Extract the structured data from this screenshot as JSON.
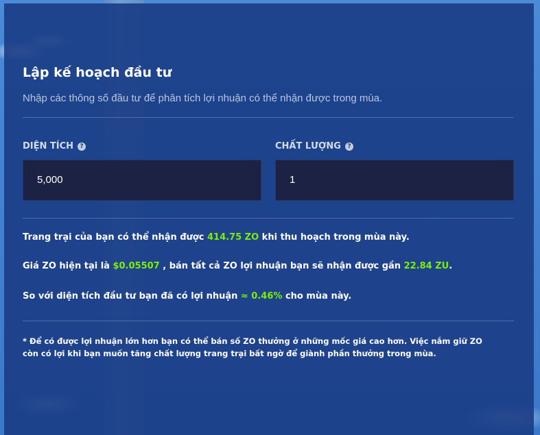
{
  "planner": {
    "title": "Lập kế hoạch đầu tư",
    "subtitle": "Nhập các thông số đầu tư để phân tích lợi nhuận có thể nhận được trong mùa."
  },
  "fields": {
    "area": {
      "label": "DIỆN TÍCH",
      "value": "5,000"
    },
    "quality": {
      "label": "CHẤT LƯỢNG",
      "value": "1"
    }
  },
  "results": {
    "line1": {
      "prefix": "Trang trại của bạn có thể nhận được ",
      "zo_amount": "414.75 ZO",
      "suffix": " khi thu hoạch trong mùa này."
    },
    "line2": {
      "prefix": "Giá ZO hiện tại là ",
      "price": "$0.05507",
      "middle": " , bán tất cả ZO lợi nhuận bạn sẽ nhận được gần ",
      "zu_amount": "22.84 ZU",
      "suffix": "."
    },
    "line3": {
      "prefix": "So với diện tích đầu tư bạn đã có lợi nhuận ",
      "percent": "≈ 0.46%",
      "suffix": " cho mùa này."
    }
  },
  "note": {
    "line1": "* Để có được lợi nhuận lớn hơn bạn có thể bán số ZO thưởng ở những mốc giá cao hơn. Việc nắm giữ ZO",
    "line2": "còn có lợi khi bạn muốn tăng chất lượng trang trại bất ngờ để giành phần thưởng trong mùa."
  },
  "icons": {
    "help": "?"
  },
  "colors": {
    "panel": "#1b3e87",
    "input": "#1c2244",
    "highlight": "#7cf000"
  }
}
